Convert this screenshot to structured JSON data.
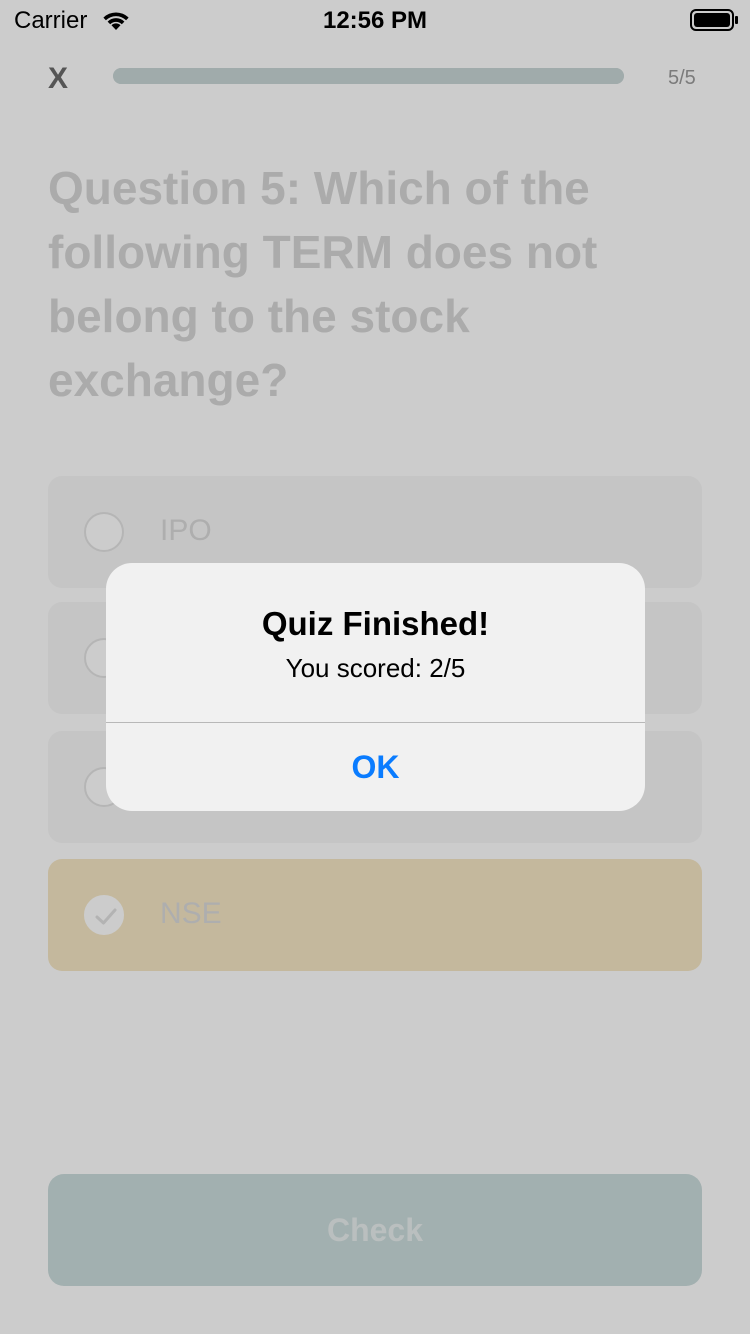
{
  "status_bar": {
    "carrier": "Carrier",
    "time": "12:56 PM",
    "wifi_icon": "wifi-icon",
    "battery_icon": "battery-icon"
  },
  "quiz": {
    "close_label": "X",
    "progress_text": "5/5",
    "progress_fraction": 1.0,
    "question": "Question 5: Which of the following TERM does not belong to the stock exchange?",
    "options": [
      {
        "label": "IPO",
        "selected": false
      },
      {
        "label": "",
        "selected": false
      },
      {
        "label": "",
        "selected": false
      },
      {
        "label": "NSE",
        "selected": true
      }
    ],
    "check_label": "Check"
  },
  "alert": {
    "title": "Quiz Finished!",
    "message": "You scored: 2/5",
    "ok_label": "OK"
  },
  "colors": {
    "accent": "#0a7cff",
    "progress": "#c9d6d6",
    "selected_option": "#f6e7c5",
    "check_button": "#cbdcdc"
  }
}
